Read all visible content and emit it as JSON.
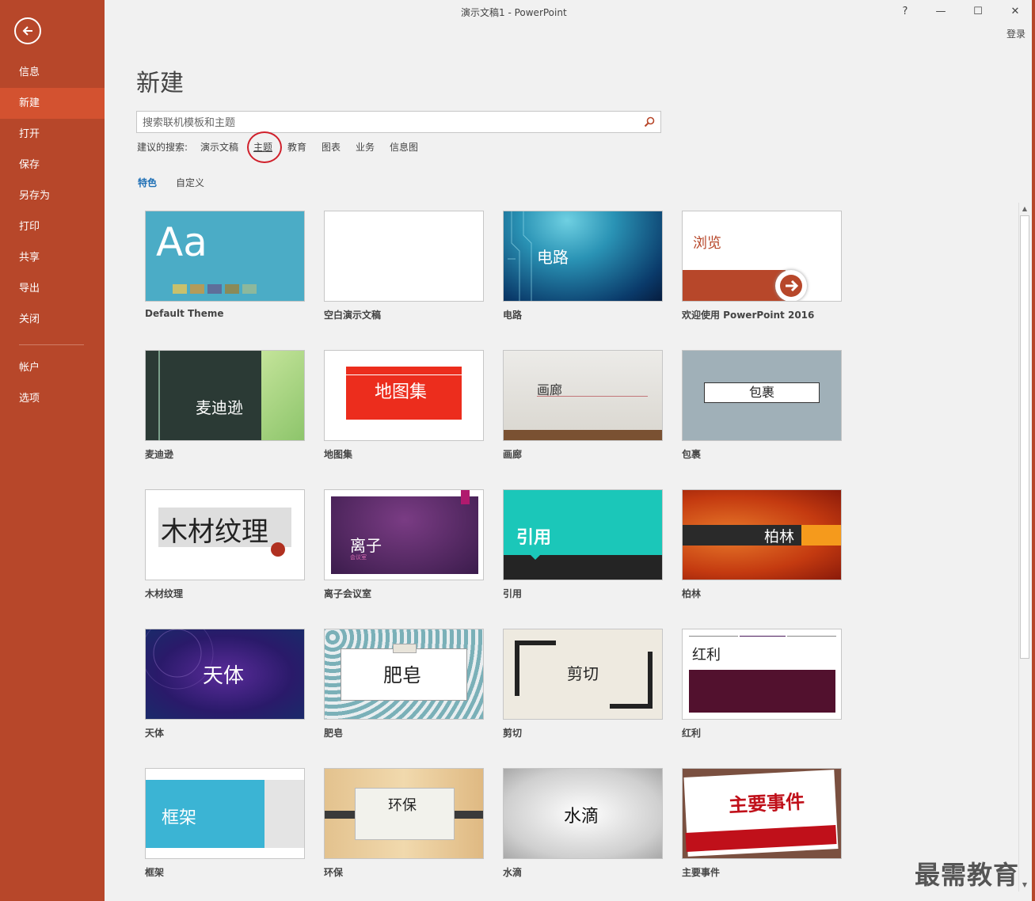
{
  "window": {
    "title": "演示文稿1 - PowerPoint",
    "help": "?",
    "minimize": "—",
    "maximize": "☐",
    "close": "✕",
    "signin": "登录"
  },
  "sidebar": {
    "items": [
      {
        "label": "信息"
      },
      {
        "label": "新建"
      },
      {
        "label": "打开"
      },
      {
        "label": "保存"
      },
      {
        "label": "另存为"
      },
      {
        "label": "打印"
      },
      {
        "label": "共享"
      },
      {
        "label": "导出"
      },
      {
        "label": "关闭"
      },
      {
        "label": "帐户"
      },
      {
        "label": "选项"
      }
    ],
    "active_index": 1
  },
  "page": {
    "title": "新建"
  },
  "search": {
    "placeholder": "搜索联机模板和主题"
  },
  "suggested": {
    "label": "建议的搜索:",
    "items": [
      "演示文稿",
      "主题",
      "教育",
      "图表",
      "业务",
      "信息图"
    ]
  },
  "filters": [
    "特色",
    "自定义"
  ],
  "templates": [
    {
      "label": "Default Theme",
      "preview": "Aa"
    },
    {
      "label": "空白演示文稿"
    },
    {
      "label": "电路",
      "preview": "电路"
    },
    {
      "label": "欢迎使用 PowerPoint 2016",
      "preview": "浏览"
    },
    {
      "label": "麦迪逊",
      "preview": "麦迪逊"
    },
    {
      "label": "地图集",
      "preview": "地图集"
    },
    {
      "label": "画廊",
      "preview": "画廊"
    },
    {
      "label": "包裹",
      "preview": "包裹"
    },
    {
      "label": "木材纹理",
      "preview": "木材纹理"
    },
    {
      "label": "离子会议室",
      "preview": "离子",
      "sub": "会议室"
    },
    {
      "label": "引用",
      "preview": "引用"
    },
    {
      "label": "柏林",
      "preview": "柏林"
    },
    {
      "label": "天体",
      "preview": "天体"
    },
    {
      "label": "肥皂",
      "preview": "肥皂"
    },
    {
      "label": "剪切",
      "preview": "剪切"
    },
    {
      "label": "红利",
      "preview": "红利"
    },
    {
      "label": "框架",
      "preview": "框架"
    },
    {
      "label": "环保",
      "preview": "环保"
    },
    {
      "label": "水滴",
      "preview": "水滴"
    },
    {
      "label": "主要事件",
      "preview": "主要事件"
    }
  ],
  "watermark": "最需教育",
  "colors": {
    "sidebar": "#b7472a",
    "sidebar_active": "#d35230",
    "accent_link": "#1e6fb5",
    "highlight": "#d0202b"
  }
}
